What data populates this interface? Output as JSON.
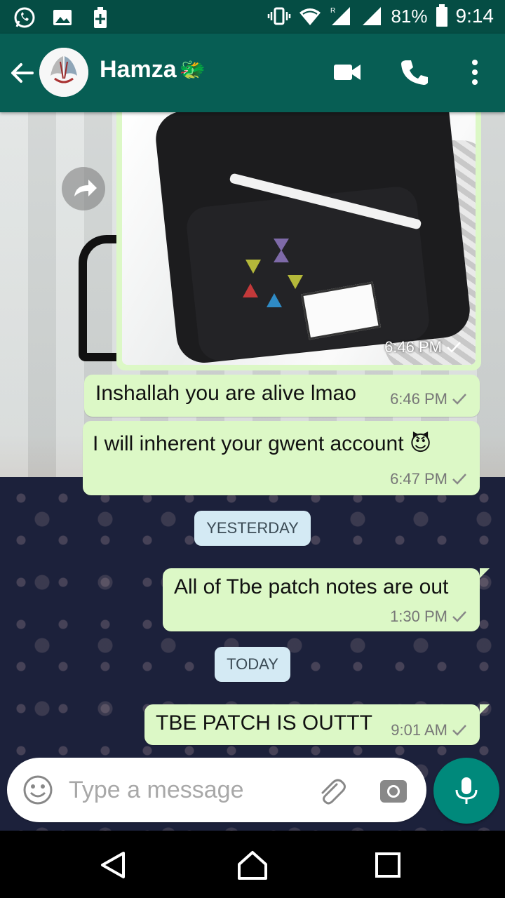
{
  "status_bar": {
    "battery_percent": "81%",
    "time": "9:14",
    "icons": [
      "whatsapp-icon",
      "gallery-icon",
      "battery-plus-icon",
      "vibrate-icon",
      "wifi-icon",
      "signal-roaming-icon",
      "signal-icon",
      "battery-icon"
    ]
  },
  "header": {
    "contact_name": "Hamza",
    "name_emoji": "🐲",
    "icons": [
      "back-arrow-icon",
      "video-call-icon",
      "phone-icon",
      "more-options-icon"
    ]
  },
  "messages": [
    {
      "type": "image",
      "time": "6:46 PM",
      "status": "sent"
    },
    {
      "type": "text",
      "text": "Inshallah you are alive lmao",
      "time": "6:46 PM",
      "status": "sent"
    },
    {
      "type": "text",
      "text": "I will inherent your gwent account 😈",
      "time": "6:47 PM",
      "status": "sent"
    },
    {
      "type": "date",
      "label": "YESTERDAY"
    },
    {
      "type": "text",
      "text": "All of Tbe patch notes are out",
      "time": "1:30 PM",
      "status": "sent"
    },
    {
      "type": "date",
      "label": "TODAY"
    },
    {
      "type": "text",
      "text": "TBE PATCH IS OUTTT",
      "time": "9:01 AM",
      "status": "sent"
    }
  ],
  "composer": {
    "placeholder": "Type a message"
  },
  "colors": {
    "header": "#075e54",
    "status_bar": "#054d44",
    "outgoing_bubble": "#dcf8c6",
    "date_chip": "#d4eaf4",
    "mic_button": "#00897b"
  }
}
